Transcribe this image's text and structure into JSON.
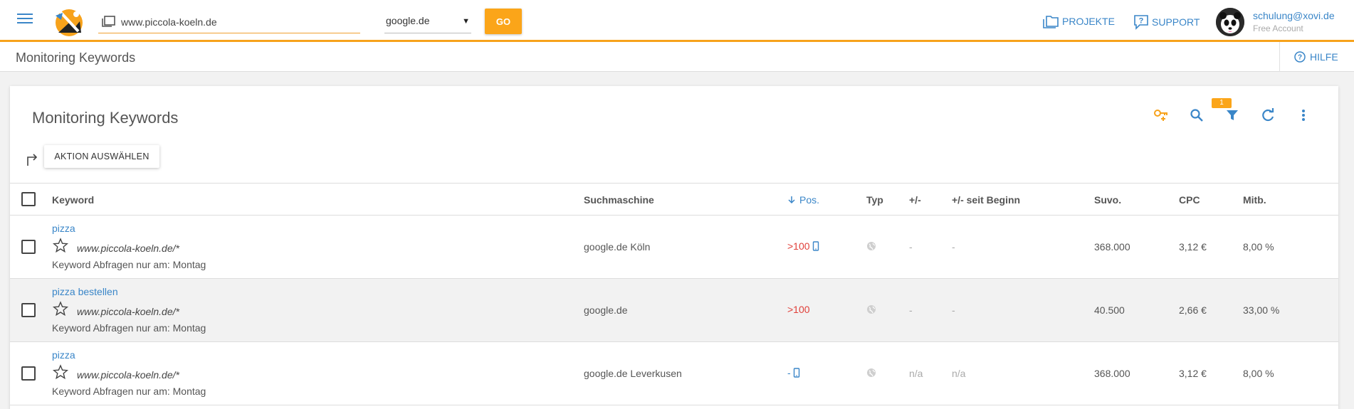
{
  "header": {
    "url_value": "www.piccola-koeln.de",
    "engine_selected": "google.de",
    "go_label": "GO",
    "projects_label": "PROJEKTE",
    "support_label": "SUPPORT",
    "user_email": "schulung@xovi.de",
    "user_plan": "Free Account"
  },
  "subbar": {
    "title": "Monitoring Keywords",
    "help_label": "HILFE"
  },
  "card": {
    "title": "Monitoring Keywords",
    "action_label": "AKTION AUSWÄHLEN",
    "filter_count": "1"
  },
  "table": {
    "columns": {
      "keyword": "Keyword",
      "engine": "Suchmaschine",
      "pos": "Pos.",
      "typ": "Typ",
      "delta": "+/-",
      "delta_since": "+/- seit Beginn",
      "suvo": "Suvo.",
      "cpc": "CPC",
      "mitb": "Mitb."
    },
    "rows": [
      {
        "keyword": "pizza",
        "url": "www.piccola-koeln.de/*",
        "note": "Keyword Abfragen nur am: Montag",
        "engine": "google.de Köln",
        "pos": ">100",
        "device": "mobile",
        "delta": "-",
        "delta_since": "-",
        "suvo": "368.000",
        "cpc": "3,12 €",
        "mitb": "8,00 %"
      },
      {
        "keyword": "pizza bestellen",
        "url": "www.piccola-koeln.de/*",
        "note": "Keyword Abfragen nur am: Montag",
        "engine": "google.de",
        "pos": ">100",
        "device": "desktop",
        "delta": "-",
        "delta_since": "-",
        "suvo": "40.500",
        "cpc": "2,66 €",
        "mitb": "33,00 %"
      },
      {
        "keyword": "pizza",
        "url": "www.piccola-koeln.de/*",
        "note": "Keyword Abfragen nur am: Montag",
        "engine": "google.de Leverkusen",
        "pos": "-",
        "device": "mobile",
        "delta": "n/a",
        "delta_since": "n/a",
        "suvo": "368.000",
        "cpc": "3,12 €",
        "mitb": "8,00 %"
      }
    ]
  },
  "colors": {
    "accent": "#f7a21b",
    "link": "#3a86c8",
    "danger": "#e0403a"
  }
}
